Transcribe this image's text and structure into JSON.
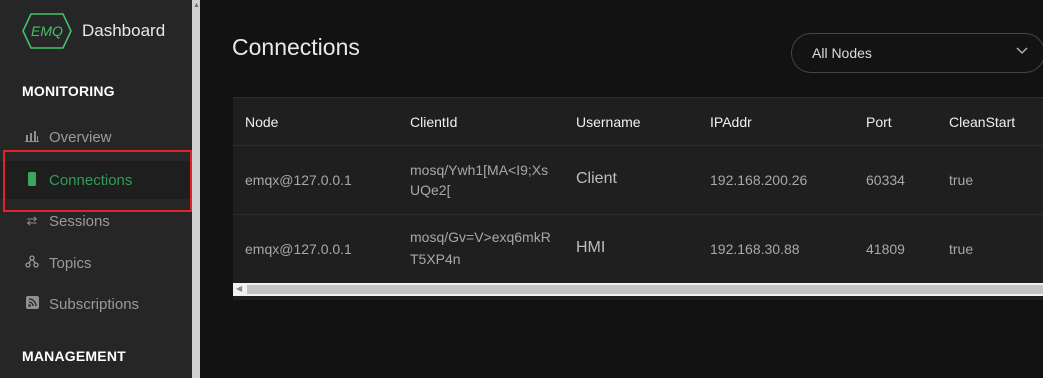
{
  "sidebar": {
    "logo_text": "EMQ",
    "app_title": "Dashboard",
    "monitoring_title": "MONITORING",
    "management_title": "MANAGEMENT",
    "items": [
      {
        "label": "Overview",
        "icon": "bar-chart-icon"
      },
      {
        "label": "Connections",
        "icon": "phone-icon"
      },
      {
        "label": "Sessions",
        "icon": "swap-arrows-icon"
      },
      {
        "label": "Topics",
        "icon": "topics-icon"
      },
      {
        "label": "Subscriptions",
        "icon": "rss-icon"
      }
    ]
  },
  "main": {
    "title": "Connections",
    "node_select": {
      "value": "All Nodes"
    },
    "table": {
      "headers": [
        "Node",
        "ClientId",
        "Username",
        "IPAddr",
        "Port",
        "CleanStart"
      ],
      "rows": [
        {
          "node": "emqx@127.0.0.1",
          "clientid_line1": "mosq/Ywh1[MA<I9;Xs",
          "clientid_line2": "UQe2[",
          "username": "Client",
          "ipaddr": "192.168.200.26",
          "port": "60334",
          "cleanstart": "true"
        },
        {
          "node": "emqx@127.0.0.1",
          "clientid_line1": "mosq/Gv=V>exq6mkR",
          "clientid_line2": "T5XP4n",
          "username": "HMI",
          "ipaddr": "192.168.30.88",
          "port": "41809",
          "cleanstart": "true"
        }
      ]
    }
  },
  "colors": {
    "accent": "#43c36b",
    "highlight": "#e0232a",
    "background": "#121212",
    "sidebar": "#262626"
  }
}
